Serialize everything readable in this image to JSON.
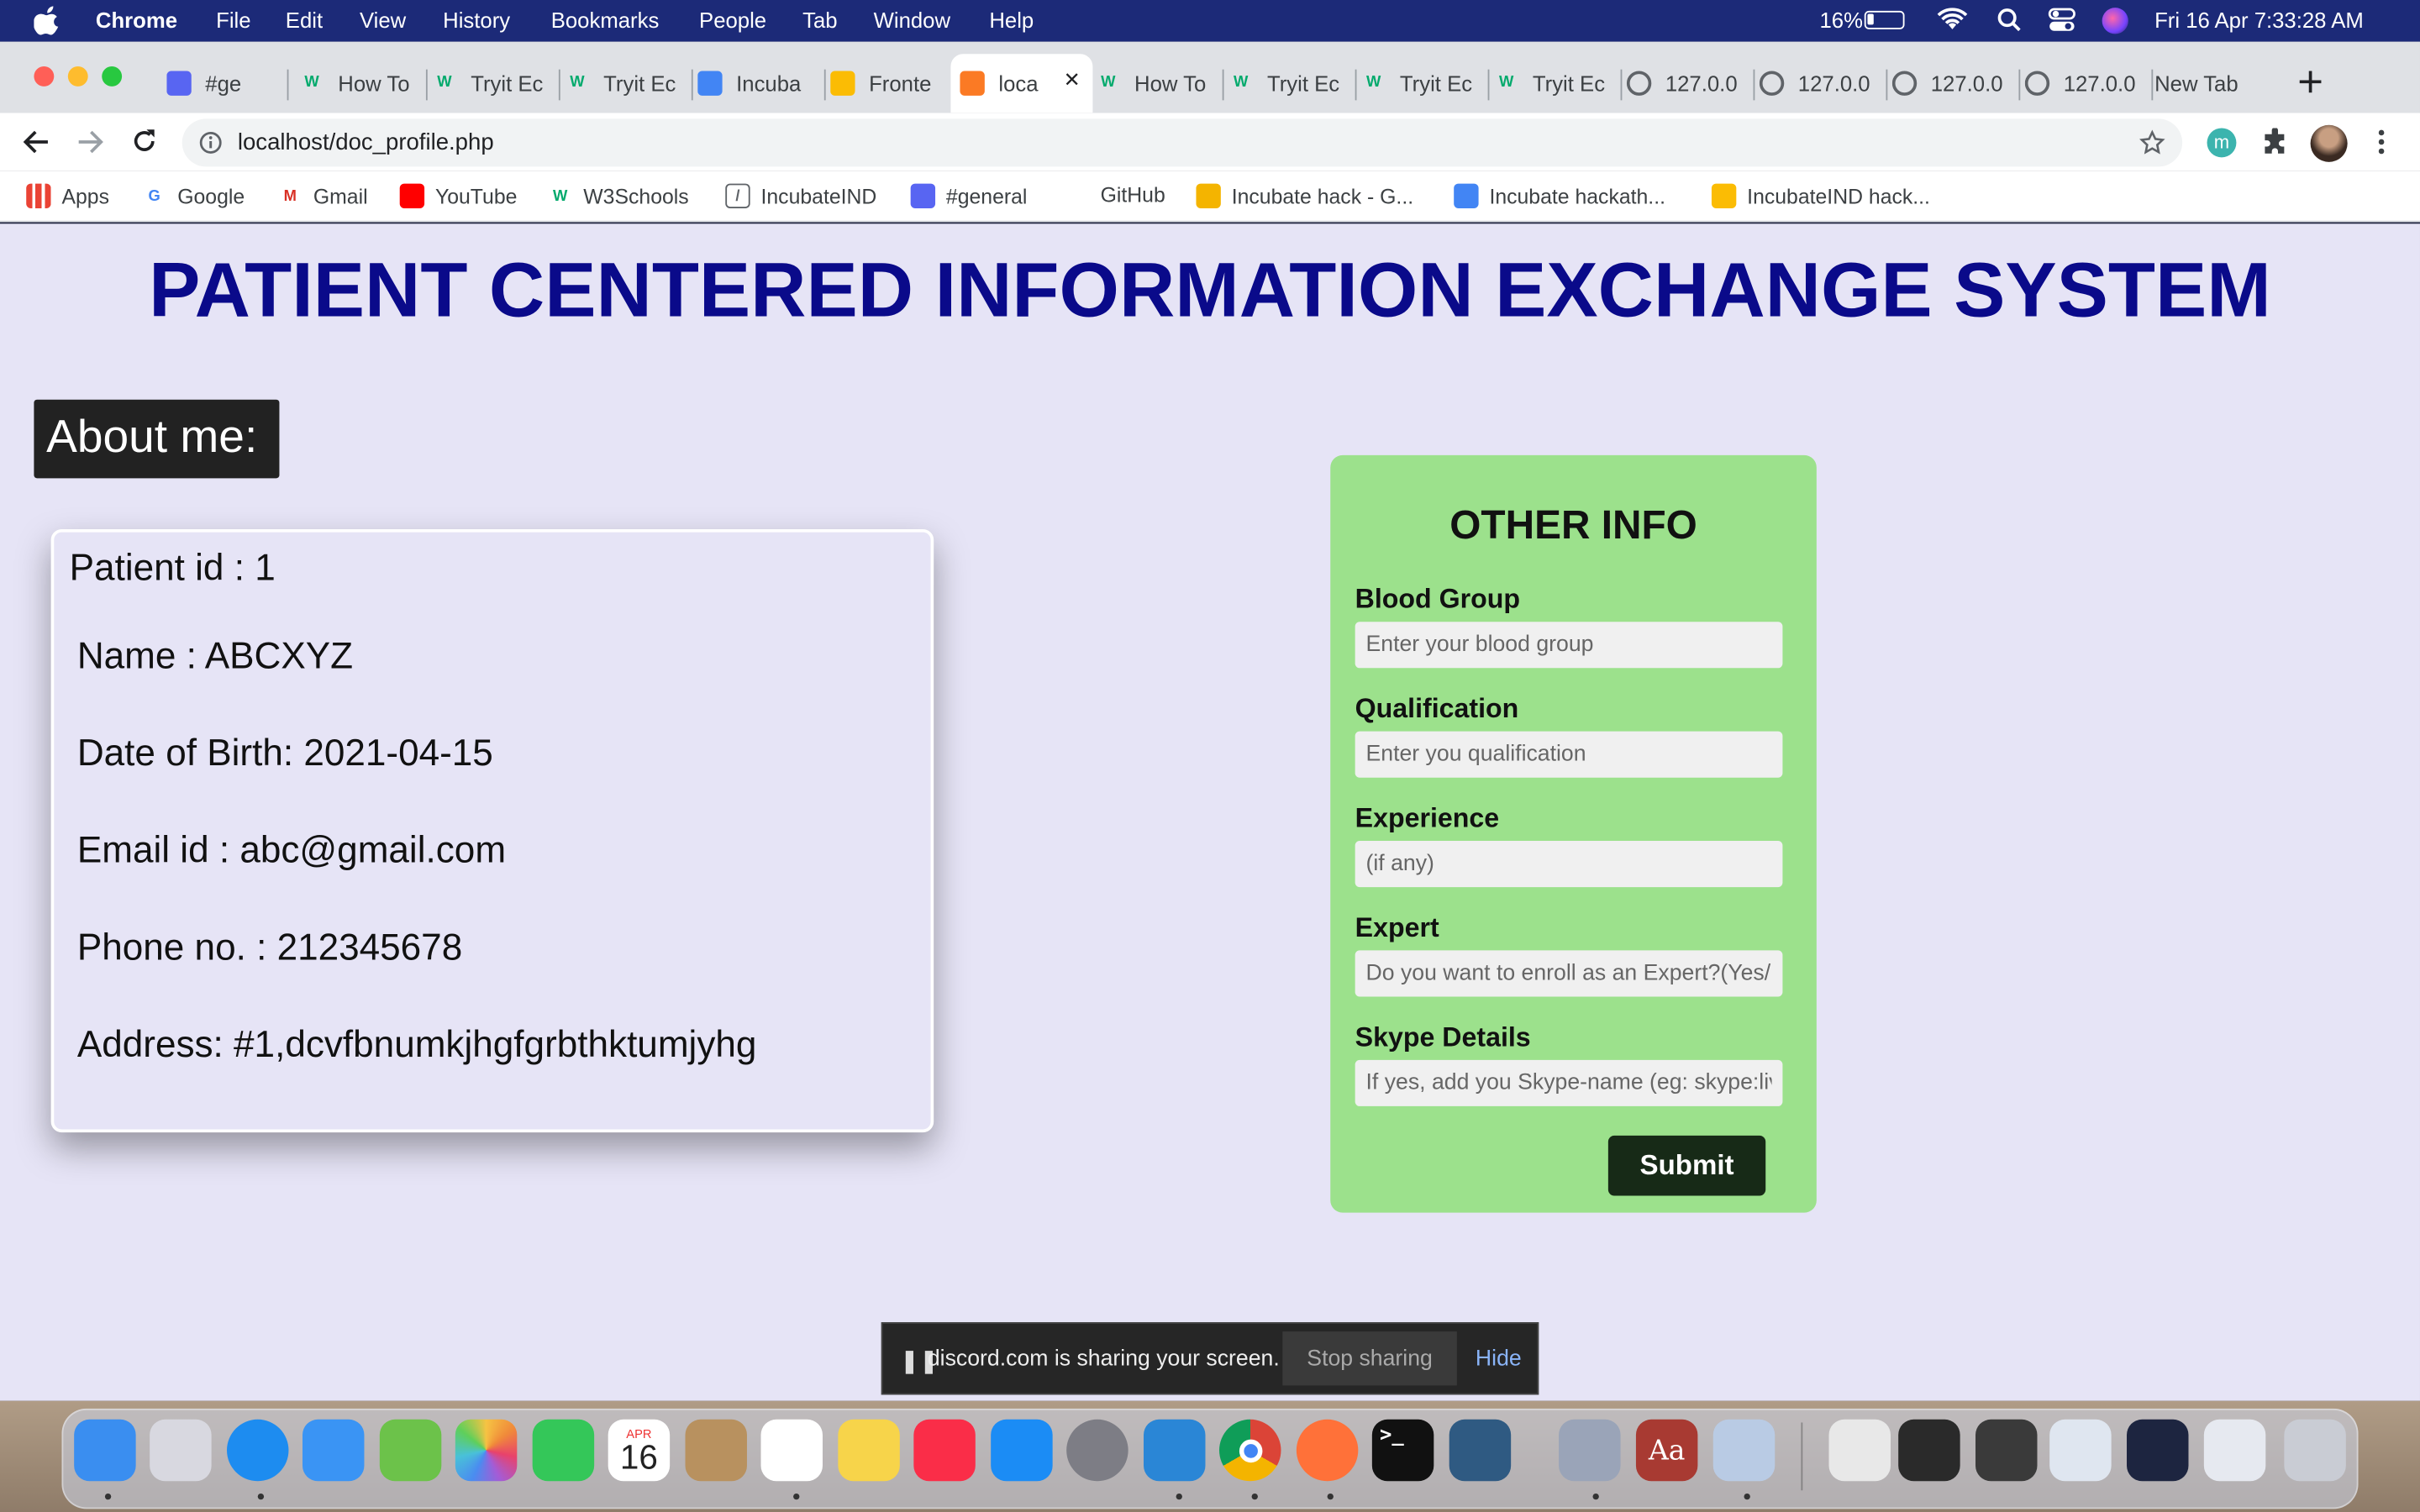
{
  "menubar": {
    "app": "Chrome",
    "items": [
      "File",
      "Edit",
      "View",
      "History",
      "Bookmarks",
      "People",
      "Tab",
      "Window",
      "Help"
    ],
    "battery": "16%",
    "datetime": "Fri 16 Apr  7:33:28 AM"
  },
  "tabs": [
    {
      "label": "#ge",
      "icon": "discord-icon",
      "color": "#5865f2"
    },
    {
      "label": "How To",
      "icon": "w3schools-icon",
      "color": "#04aa6d"
    },
    {
      "label": "Tryit Ec",
      "icon": "w3schools-icon",
      "color": "#04aa6d"
    },
    {
      "label": "Tryit Ec",
      "icon": "w3schools-icon",
      "color": "#04aa6d"
    },
    {
      "label": "Incuba",
      "icon": "docs-icon",
      "color": "#4285f4"
    },
    {
      "label": "Fronte",
      "icon": "drive-icon",
      "color": "#fbbc04"
    },
    {
      "label": "loca",
      "icon": "xampp-icon",
      "color": "#fb7a24"
    },
    {
      "label": "How To",
      "icon": "w3schools-icon",
      "color": "#04aa6d"
    },
    {
      "label": "Tryit Ec",
      "icon": "w3schools-icon",
      "color": "#04aa6d"
    },
    {
      "label": "Tryit Ec",
      "icon": "w3schools-icon",
      "color": "#04aa6d"
    },
    {
      "label": "Tryit Ec",
      "icon": "w3schools-icon",
      "color": "#04aa6d"
    },
    {
      "label": "127.0.0",
      "icon": "globe-icon",
      "color": "#5f6368"
    },
    {
      "label": "127.0.0",
      "icon": "globe-icon",
      "color": "#5f6368"
    },
    {
      "label": "127.0.0",
      "icon": "globe-icon",
      "color": "#5f6368"
    },
    {
      "label": "127.0.0",
      "icon": "globe-icon",
      "color": "#5f6368"
    },
    {
      "label": "New Tab",
      "icon": "",
      "color": ""
    }
  ],
  "address": {
    "url": "localhost/doc_profile.php"
  },
  "bookmarks": [
    {
      "label": "Apps",
      "icon": "apps-grid-icon",
      "color": "#ea4335"
    },
    {
      "label": "Google",
      "icon": "google-icon",
      "color": "#4285f4"
    },
    {
      "label": "Gmail",
      "icon": "gmail-icon",
      "color": "#d93025"
    },
    {
      "label": "YouTube",
      "icon": "youtube-icon",
      "color": "#ff0000"
    },
    {
      "label": "W3Schools",
      "icon": "w3schools-icon",
      "color": "#04aa6d"
    },
    {
      "label": "IncubateIND",
      "icon": "code-icon",
      "color": "#5f6368"
    },
    {
      "label": "#general",
      "icon": "discord-icon",
      "color": "#5865f2"
    },
    {
      "label": "GitHub",
      "icon": "",
      "color": ""
    },
    {
      "label": "Incubate hack - G...",
      "icon": "hand-icon",
      "color": "#f4b400"
    },
    {
      "label": "Incubate hackath...",
      "icon": "docs-icon",
      "color": "#4285f4"
    },
    {
      "label": "IncubateIND hack...",
      "icon": "drive-icon",
      "color": "#fbbc04"
    }
  ],
  "page": {
    "title": "PATIENT CENTERED INFORMATION EXCHANGE SYSTEM",
    "about_label": "About me:",
    "profile": {
      "patient_id": "Patient id : 1",
      "name": "Name : ABCXYZ",
      "dob": "Date of Birth: 2021-04-15",
      "email": "Email id : abc@gmail.com",
      "phone": "Phone no. : 212345678",
      "address": "Address: #1,dcvfbnumkjhgfgrbthktumjyhg"
    },
    "other_info": {
      "heading": "OTHER INFO",
      "blood_group_label": "Blood Group",
      "blood_group_placeholder": "Enter your blood group",
      "qualification_label": "Qualification",
      "qualification_placeholder": "Enter you qualification",
      "experience_label": "Experience",
      "experience_placeholder": "(if any)",
      "expert_label": "Expert",
      "expert_placeholder": "Do you want to enroll as an Expert?(Yes/No)",
      "skype_label": "Skype Details",
      "skype_placeholder": "If yes, add you Skype-name (eg: skype:live:...)",
      "submit": "Submit"
    }
  },
  "share_bar": {
    "message": "discord.com is sharing your screen.",
    "stop": "Stop sharing",
    "hide": "Hide"
  },
  "dock": {
    "calendar_month": "APR",
    "calendar_day": "16",
    "dictionary_label": "Aa"
  }
}
